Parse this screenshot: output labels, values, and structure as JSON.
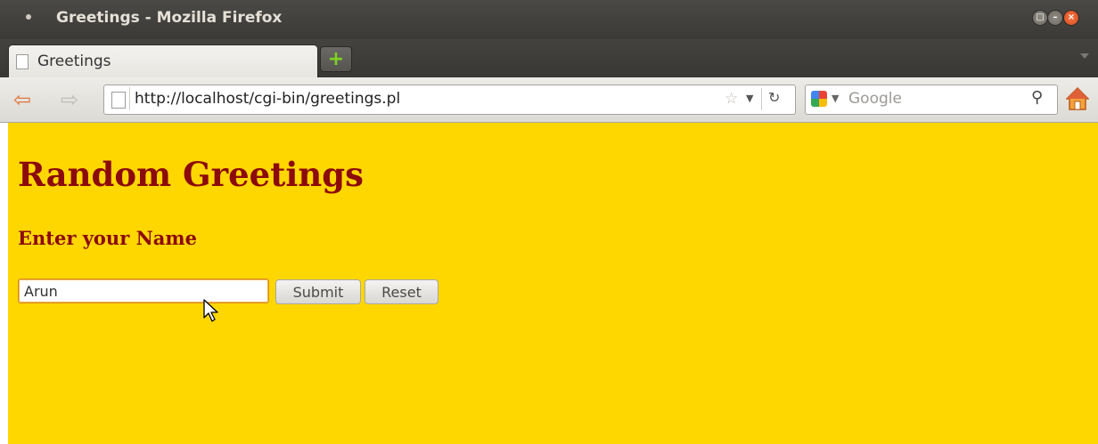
{
  "window": {
    "title": "Greetings - Mozilla Firefox"
  },
  "tabs": [
    {
      "label": "Greetings",
      "active": true
    }
  ],
  "newtab": {
    "icon": "plus-icon",
    "color": "#7ed321"
  },
  "navbar": {
    "url": "http://localhost/cgi-bin/greetings.pl",
    "search_engine": "Google",
    "search_placeholder": "Google"
  },
  "page": {
    "background": "#ffd700",
    "heading_color": "#8b0a0a",
    "title": "Random Greetings",
    "subtitle": "Enter your Name",
    "form": {
      "name_value": "Arun",
      "submit_label": "Submit",
      "reset_label": "Reset"
    }
  }
}
